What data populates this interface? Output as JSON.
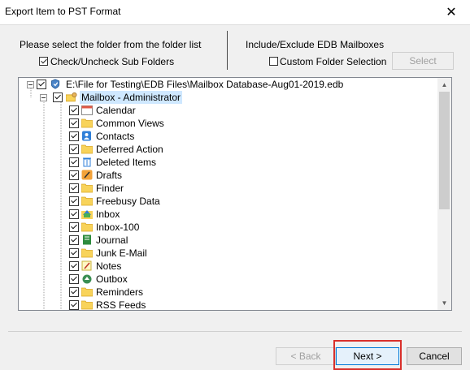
{
  "window": {
    "title": "Export Item to PST Format",
    "close_glyph": "✕"
  },
  "left_panel": {
    "instruction": "Please select the folder from the folder list",
    "subfolders_label": "Check/Uncheck Sub Folders",
    "subfolders_checked": true
  },
  "right_panel": {
    "heading": "Include/Exclude EDB Mailboxes",
    "custom_label": "Custom Folder Selection",
    "custom_checked": false,
    "select_button": "Select"
  },
  "tree": {
    "root": "E:\\File for Testing\\EDB Files\\Mailbox Database-Aug01-2019.edb",
    "mailbox": "Mailbox - Administrator",
    "folders": [
      {
        "label": "Calendar",
        "icon": "calendar-icon"
      },
      {
        "label": "Common Views",
        "icon": "folder-icon"
      },
      {
        "label": "Contacts",
        "icon": "contacts-icon"
      },
      {
        "label": "Deferred Action",
        "icon": "folder-icon"
      },
      {
        "label": "Deleted Items",
        "icon": "trash-icon"
      },
      {
        "label": "Drafts",
        "icon": "drafts-icon"
      },
      {
        "label": "Finder",
        "icon": "folder-icon"
      },
      {
        "label": "Freebusy Data",
        "icon": "folder-icon"
      },
      {
        "label": "Inbox",
        "icon": "inbox-icon"
      },
      {
        "label": "Inbox-100",
        "icon": "folder-icon"
      },
      {
        "label": "Journal",
        "icon": "journal-icon"
      },
      {
        "label": "Junk E-Mail",
        "icon": "folder-icon"
      },
      {
        "label": "Notes",
        "icon": "notes-icon"
      },
      {
        "label": "Outbox",
        "icon": "outbox-icon"
      },
      {
        "label": "Reminders",
        "icon": "folder-icon"
      },
      {
        "label": "RSS Feeds",
        "icon": "folder-icon"
      }
    ]
  },
  "footer": {
    "back_button": "< Back",
    "next_button": "Next >",
    "cancel_button": "Cancel",
    "highlight_color": "#d9302b"
  }
}
